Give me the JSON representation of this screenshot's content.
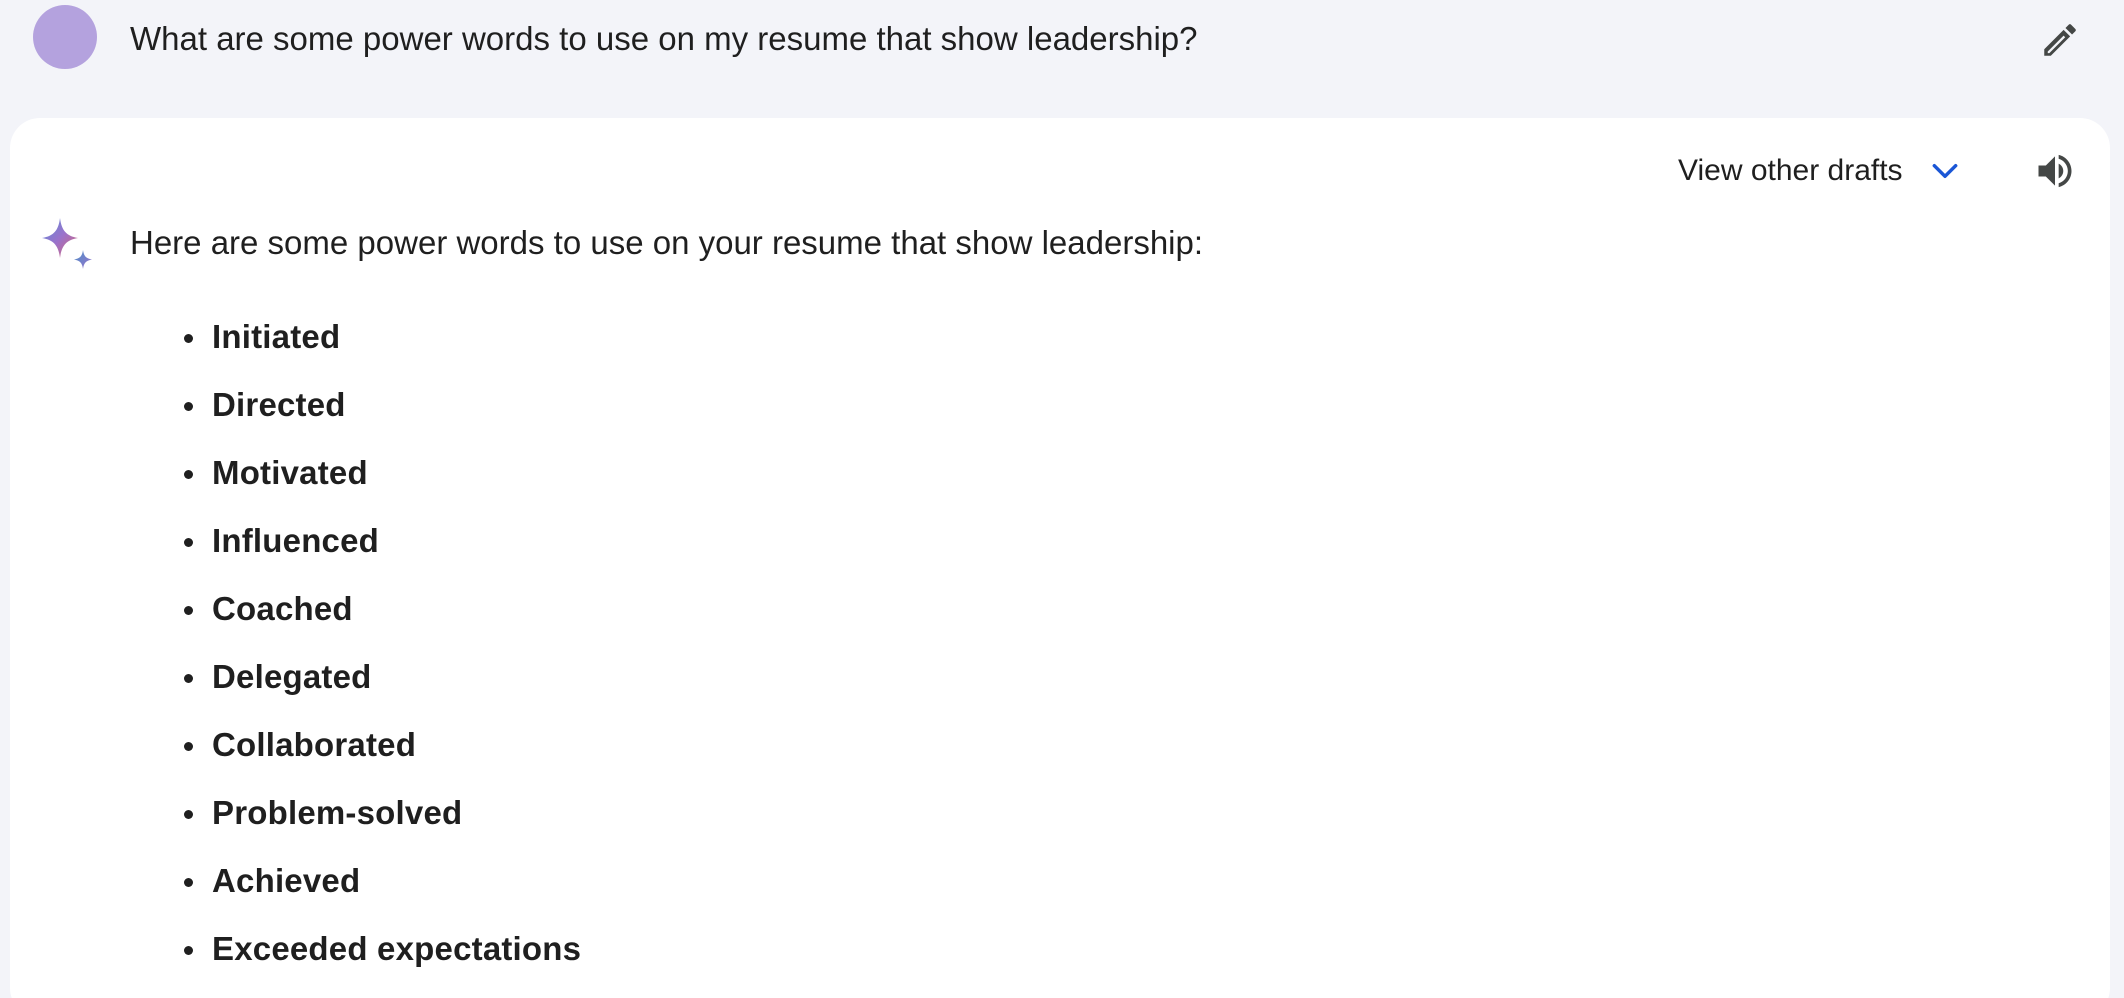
{
  "prompt": {
    "avatar_icon": "user-avatar",
    "text": "What are some power words to use on my resume that show leadership?",
    "edit_icon": "pencil-icon"
  },
  "response": {
    "drafts_label": "View other drafts",
    "drafts_icon": "chevron-down-icon",
    "speaker_icon": "volume-icon",
    "model_icon": "sparkle-icon",
    "intro": "Here are some power words to use on your resume that show leadership:",
    "words": [
      "Initiated",
      "Directed",
      "Motivated",
      "Influenced",
      "Coached",
      "Delegated",
      "Collaborated",
      "Problem-solved",
      "Achieved",
      "Exceeded expectations"
    ]
  },
  "colors": {
    "page_background": "#f3f4f9",
    "card_background": "#ffffff",
    "avatar": "#b4a2de",
    "accent_blue": "#1a56d6",
    "text": "#1f1f1f"
  }
}
